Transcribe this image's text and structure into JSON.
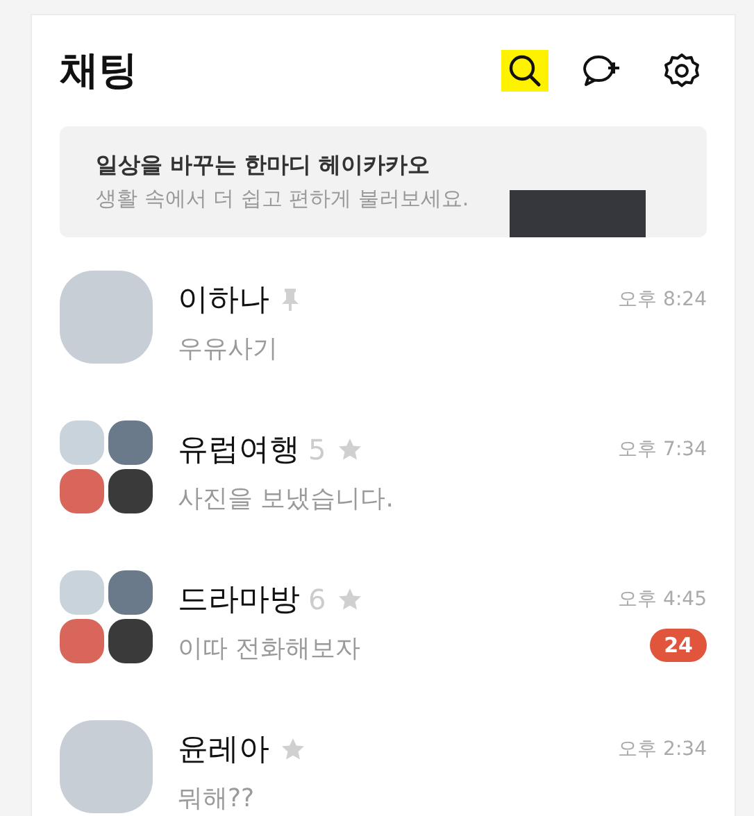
{
  "header": {
    "title": "채팅",
    "actions": [
      {
        "kind": "search",
        "highlighted": true
      },
      {
        "kind": "new-chat",
        "highlighted": false
      },
      {
        "kind": "settings",
        "highlighted": false
      }
    ]
  },
  "banner": {
    "title": "일상을 바꾸는 한마디 헤이카카오",
    "subtitle": "생활 속에서 더 쉽고 편하게 불러보세요."
  },
  "chats": [
    {
      "kind": "single",
      "name": "이하나",
      "pinned": true,
      "favorite": false,
      "time": "오후 8:24",
      "preview": "우유사기"
    },
    {
      "kind": "group",
      "name": "유럽여행",
      "members": "5",
      "pinned": false,
      "favorite": true,
      "time": "오후 7:34",
      "preview": "사진을 보냈습니다."
    },
    {
      "kind": "group",
      "name": "드라마방",
      "members": "6",
      "pinned": false,
      "favorite": true,
      "time": "오후 4:45",
      "preview": "이따 전화해보자",
      "unread": "24"
    },
    {
      "kind": "single",
      "name": "윤레아",
      "pinned": false,
      "favorite": true,
      "time": "오후 2:34",
      "preview": "뭐해??"
    }
  ]
}
